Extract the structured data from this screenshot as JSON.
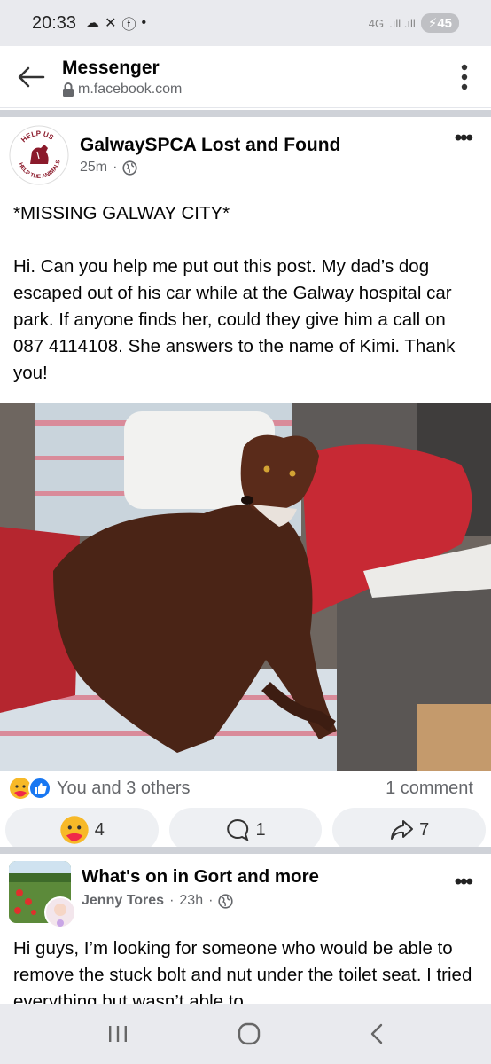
{
  "status_bar": {
    "time": "20:33",
    "network": "4G",
    "battery": "45"
  },
  "app_bar": {
    "title": "Messenger",
    "url": "m.facebook.com"
  },
  "post1": {
    "author": "GalwaySPCA Lost and Found",
    "time": "25m",
    "separator": "·",
    "avatar_text_top": "HELP US",
    "avatar_text_bottom": "HELP THE ANIMALS",
    "headline": "*MISSING GALWAY CITY*",
    "body": "Hi. Can you help me put out this post. My dad’s dog escaped out of his car while at the Galway hospital car park. If anyone finds her, could they give him a call on 087 4114108. She answers to the name of Kimi. Thank you!",
    "reactions_text": "You and 3 others",
    "comments_text": "1 comment",
    "care_count": "4",
    "comment_count": "1",
    "share_count": "7"
  },
  "post2": {
    "group": "What's on in Gort and more",
    "author": "Jenny Tores",
    "time": "23h",
    "separator": "·",
    "body": "Hi guys, I’m looking for someone who would be able to remove the stuck bolt and nut under the toilet seat. I tried everything but wasn’t able to"
  },
  "colors": {
    "fb_blue": "#1877f2",
    "care_yellow": "#f7b928",
    "text_secondary": "#65676b",
    "spca_red": "#8b1a2b"
  }
}
